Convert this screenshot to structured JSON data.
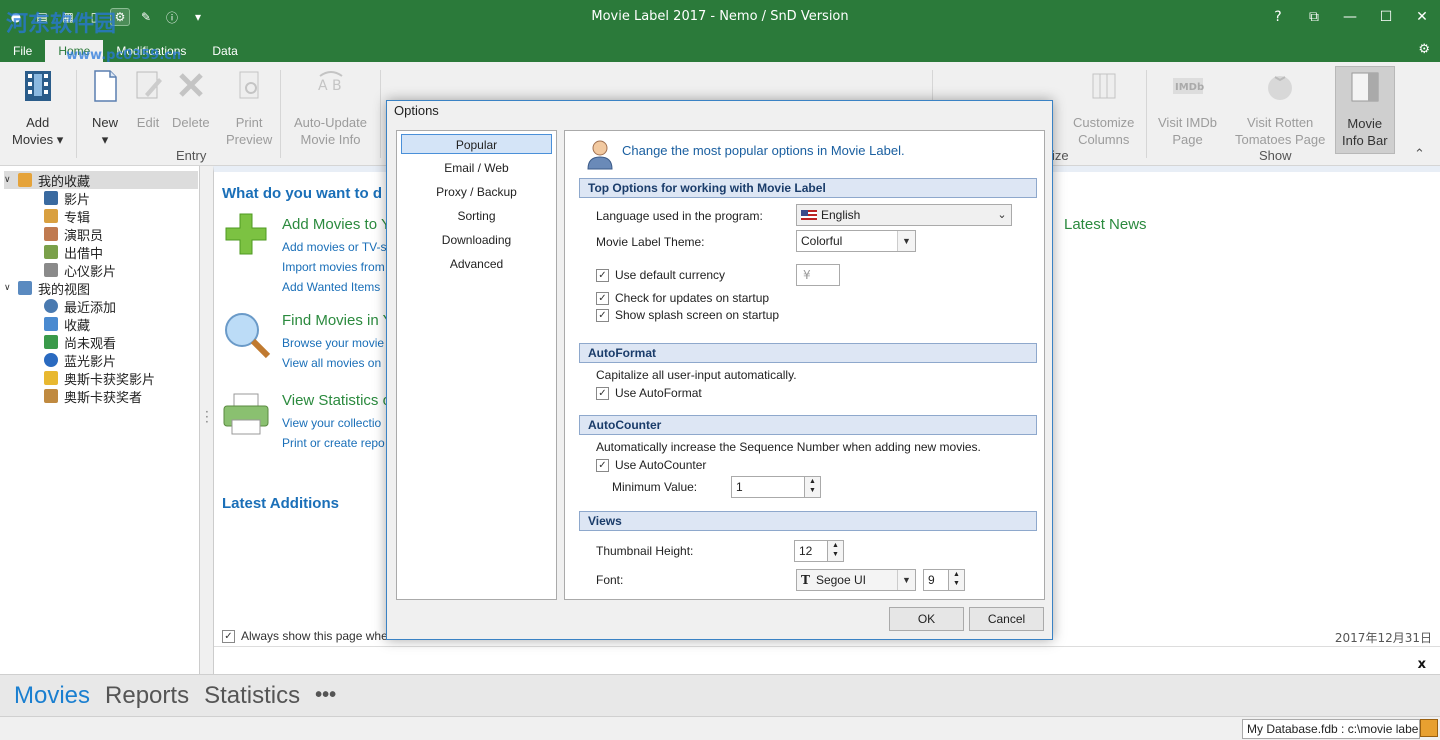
{
  "app": {
    "title": "Movie Label 2017 - Nemo / SnD Version",
    "watermark": "河东软件园",
    "watermark_url": "www.pc0359.cn",
    "tabs": [
      "File",
      "Home",
      "Modifications",
      "Data"
    ],
    "active_tab": "Home",
    "window_buttons": [
      "?",
      "⧉",
      "—",
      "☐",
      "✕"
    ]
  },
  "ribbon": {
    "buttons": [
      {
        "label": "Add\nMovies ▾",
        "state": "normal"
      },
      {
        "label": "New\n▾",
        "state": "normal"
      },
      {
        "label": "Edit",
        "state": "disabled"
      },
      {
        "label": "Delete",
        "state": "disabled"
      },
      {
        "label": "Print\nPreview",
        "state": "disabled"
      },
      {
        "label": "Auto-Update\nMovie Info",
        "state": "disabled"
      },
      {
        "label": "Customize\nColumns",
        "state": "disabled"
      },
      {
        "label": "Visit IMDb\nPage",
        "state": "disabled"
      },
      {
        "label": "Visit Rotten\nTomatoes Page",
        "state": "disabled"
      },
      {
        "label": "Movie\nInfo Bar",
        "state": "pressed"
      }
    ],
    "groups": [
      "Entry",
      "ize",
      "Show"
    ]
  },
  "tree": {
    "root1": "我的收藏",
    "root1_items": [
      "影片",
      "专辑",
      "演职员",
      "出借中",
      "心仪影片"
    ],
    "root2": "我的视图",
    "root2_items": [
      "最近添加",
      "收藏",
      "尚未观看",
      "蓝光影片",
      "奥斯卡获奖影片",
      "奥斯卡获奖者"
    ]
  },
  "start": {
    "heading": "What do you want to d",
    "actions": [
      {
        "title": "Add Movies to Y",
        "links": [
          "Add movies or TV-s",
          "Import movies from",
          "Add Wanted Items"
        ]
      },
      {
        "title": "Find Movies in Y",
        "links": [
          "Browse your movie",
          "View all movies on"
        ]
      },
      {
        "title": "View Statistics o",
        "links": [
          "View your collectio",
          "Print or create repo"
        ]
      }
    ],
    "latest_additions": "Latest Additions",
    "latest_news": "Latest News",
    "always_show": "Always show this page whe",
    "date": "2017年12月31日",
    "close": "x"
  },
  "nav": {
    "items": [
      "Movies",
      "Reports",
      "Statistics",
      "•••"
    ],
    "active": "Movies"
  },
  "status": {
    "database": "My Database.fdb  :  c:\\movie labe"
  },
  "dialog": {
    "title": "Options",
    "nav": [
      "Popular",
      "Email / Web",
      "Proxy / Backup",
      "Sorting",
      "Downloading",
      "Advanced"
    ],
    "selected_nav": "Popular",
    "header": "Change the most popular options in Movie Label.",
    "sections": {
      "top": "Top Options for working with Movie Label",
      "autoformat": "AutoFormat",
      "autocounter": "AutoCounter",
      "views": "Views"
    },
    "language_label": "Language used in the program:",
    "language_value": "English",
    "theme_label": "Movie Label Theme:",
    "theme_value": "Colorful",
    "currency_label": "Use default currency",
    "currency_value": "¥",
    "check_updates": "Check for updates on startup",
    "splash": "Show splash screen on startup",
    "autoformat_desc": "Capitalize all user-input automatically.",
    "use_autoformat": "Use AutoFormat",
    "autocounter_desc": "Automatically increase the Sequence Number when adding new movies.",
    "use_autocounter": "Use AutoCounter",
    "min_value_label": "Minimum Value:",
    "min_value": "1",
    "thumb_label": "Thumbnail Height:",
    "thumb_value": "12",
    "font_label": "Font:",
    "font_value": "Segoe UI",
    "font_size": "9",
    "ok": "OK",
    "cancel": "Cancel"
  },
  "colors": {
    "titlebar": "#2b7a3a",
    "link": "#1a6fb8",
    "action": "#2b8a3e",
    "accent": "#1a7fd0"
  }
}
